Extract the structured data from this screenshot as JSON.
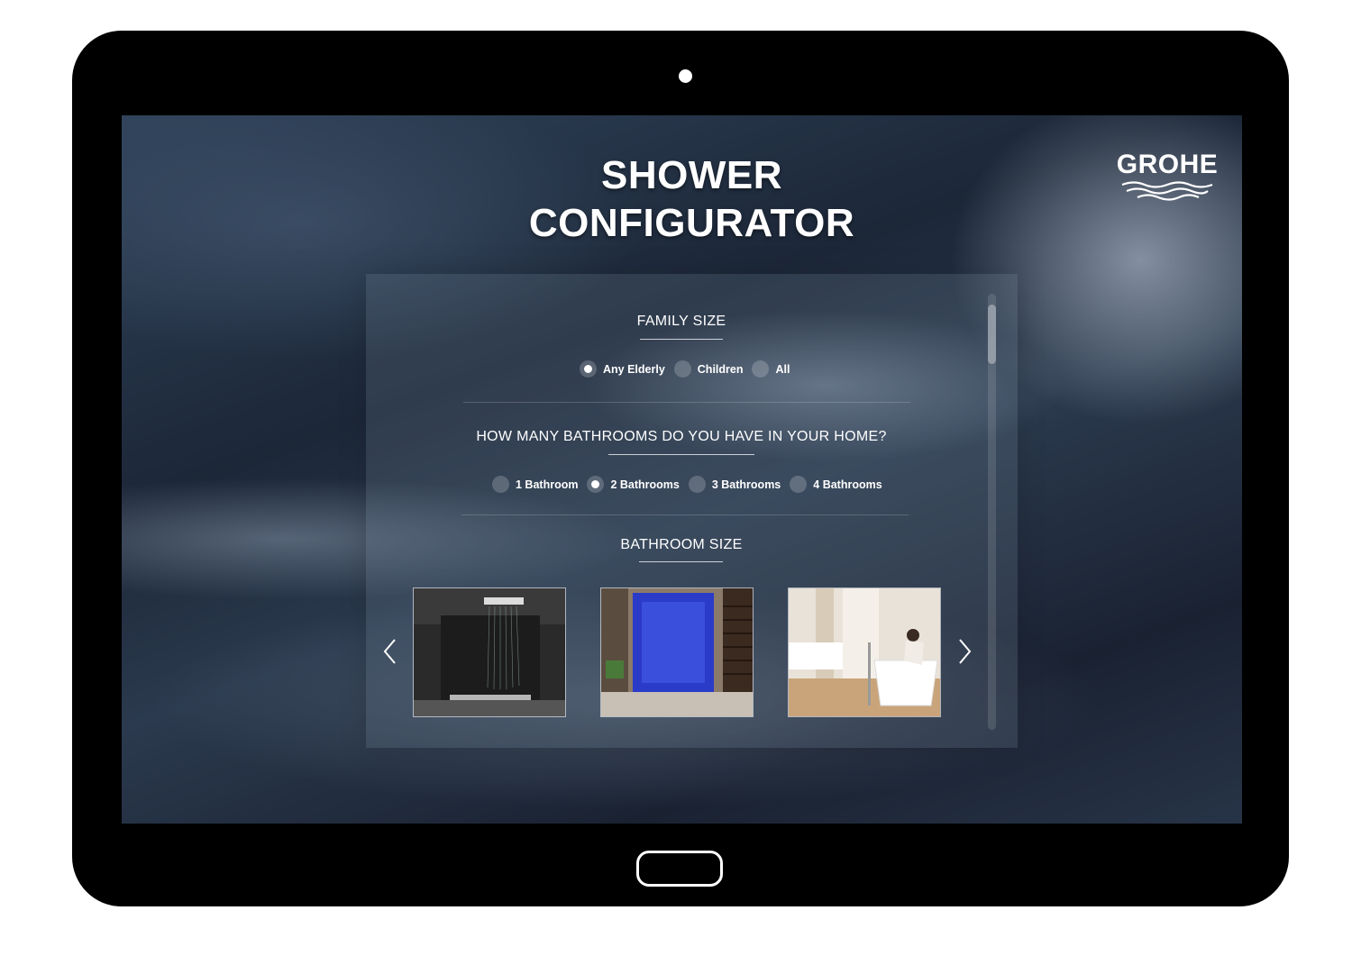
{
  "app": {
    "title_line1": "SHOWER",
    "title_line2": "CONFIGURATOR",
    "brand": "GROHE"
  },
  "family_size": {
    "heading": "FAMILY SIZE",
    "options": [
      {
        "label": "Any Elderly",
        "selected": true
      },
      {
        "label": "Children",
        "selected": false
      },
      {
        "label": "All",
        "selected": false
      }
    ]
  },
  "bathrooms": {
    "heading": "HOW MANY BATHROOMS DO YOU HAVE IN YOUR HOME?",
    "options": [
      {
        "label": "1 Bathroom",
        "selected": false
      },
      {
        "label": "2 Bathrooms",
        "selected": true
      },
      {
        "label": "3 Bathrooms",
        "selected": false
      },
      {
        "label": "4 Bathrooms",
        "selected": false
      }
    ]
  },
  "bathroom_size": {
    "heading": "BATHROOM SIZE",
    "images": [
      "rain-shower-dark-stone",
      "blue-lit-steam-shower",
      "freestanding-bathtub-bright-room"
    ],
    "prev_icon": "chevron-left-icon",
    "next_icon": "chevron-right-icon"
  },
  "colors": {
    "background": "#1f2a3a",
    "text": "#ffffff",
    "device_frame": "#000000"
  }
}
